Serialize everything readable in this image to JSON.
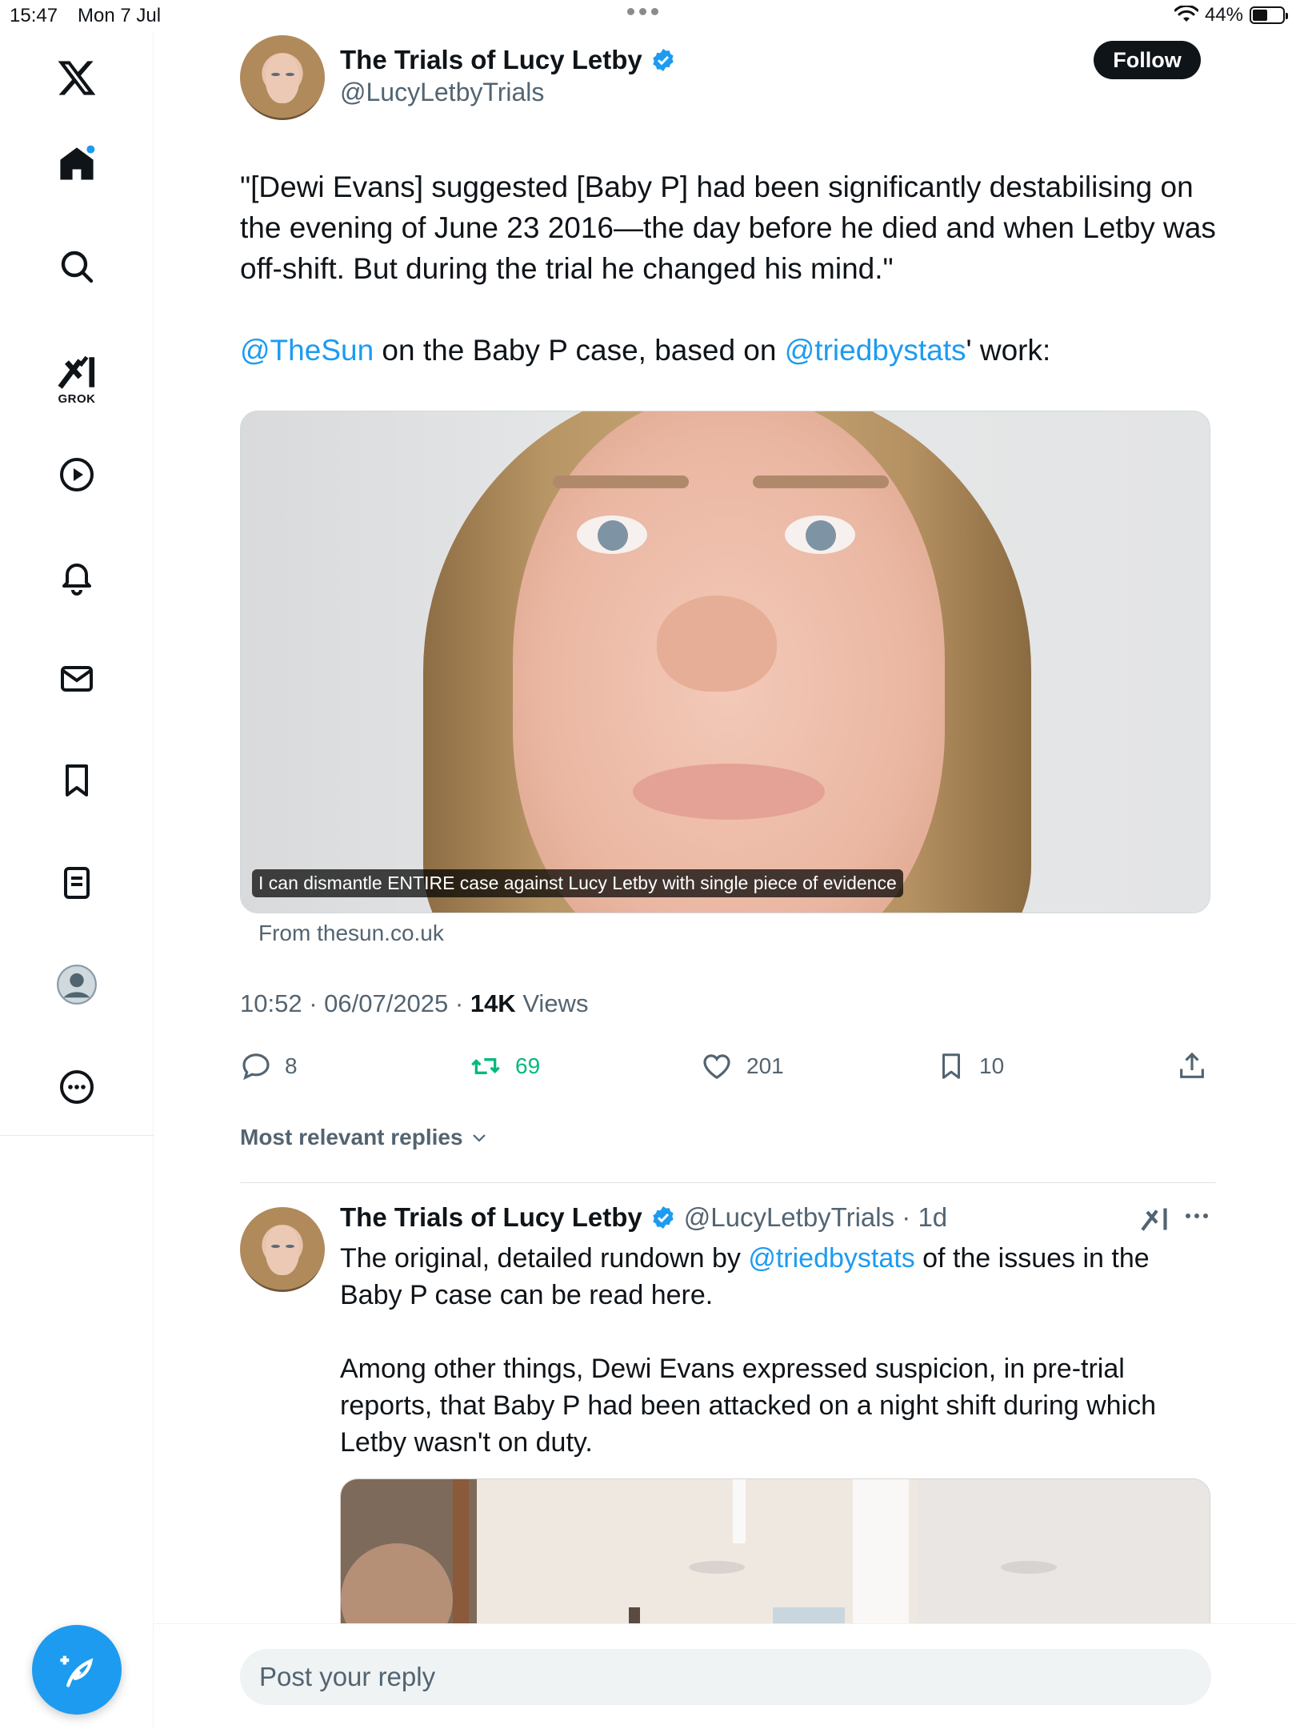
{
  "status_bar": {
    "time": "15:47",
    "date": "Mon 7 Jul",
    "battery": "44%"
  },
  "sidebar": {
    "grok_label": "GROK",
    "items": [
      "home",
      "explore",
      "grok",
      "video",
      "notifications",
      "messages",
      "bookmarks",
      "lists",
      "profile",
      "more"
    ]
  },
  "tweet": {
    "author_name": "The Trials of Lucy Letby",
    "author_handle": "@LucyLetbyTrials",
    "follow_label": "Follow",
    "text_p1": "\"[Dewi Evans] suggested [Baby P] had been significantly destabilising on the evening of June 23 2016—the day before he died and when Letby was off-shift. But during the trial he changed his mind.\"",
    "mention_sun": "@TheSun",
    "text_mid": " on the Baby P case, based on ",
    "mention_stats": "@triedbystats",
    "text_end": "' work:",
    "media_caption": "I can dismantle ENTIRE case against Lucy Letby with single piece of evidence",
    "source": "From thesun.co.uk",
    "timestamp": "10:52 · 06/07/2025 · ",
    "views_count": "14K",
    "views_label": " Views",
    "replies": "8",
    "reposts": "69",
    "likes": "201",
    "bookmarks": "10"
  },
  "replies_sort": "Most relevant replies",
  "reply": {
    "author_name": "The Trials of Lucy Letby",
    "handle_time": "@LucyLetbyTrials · 1d",
    "p1_start": "The original, detailed rundown by ",
    "p1_mention": "@triedbystats",
    "p1_end": " of the issues in the Baby P case can be read here.",
    "p2": "Among other things, Dewi Evans expressed suspicion, in pre-trial reports, that Baby P had been attacked on a night shift during which Letby wasn't on duty."
  },
  "reply_input": {
    "placeholder": "Post your reply"
  },
  "colors": {
    "accent": "#1d9bf0",
    "repost": "#00ba7c",
    "text": "#0f1419",
    "secondary": "#536471"
  }
}
